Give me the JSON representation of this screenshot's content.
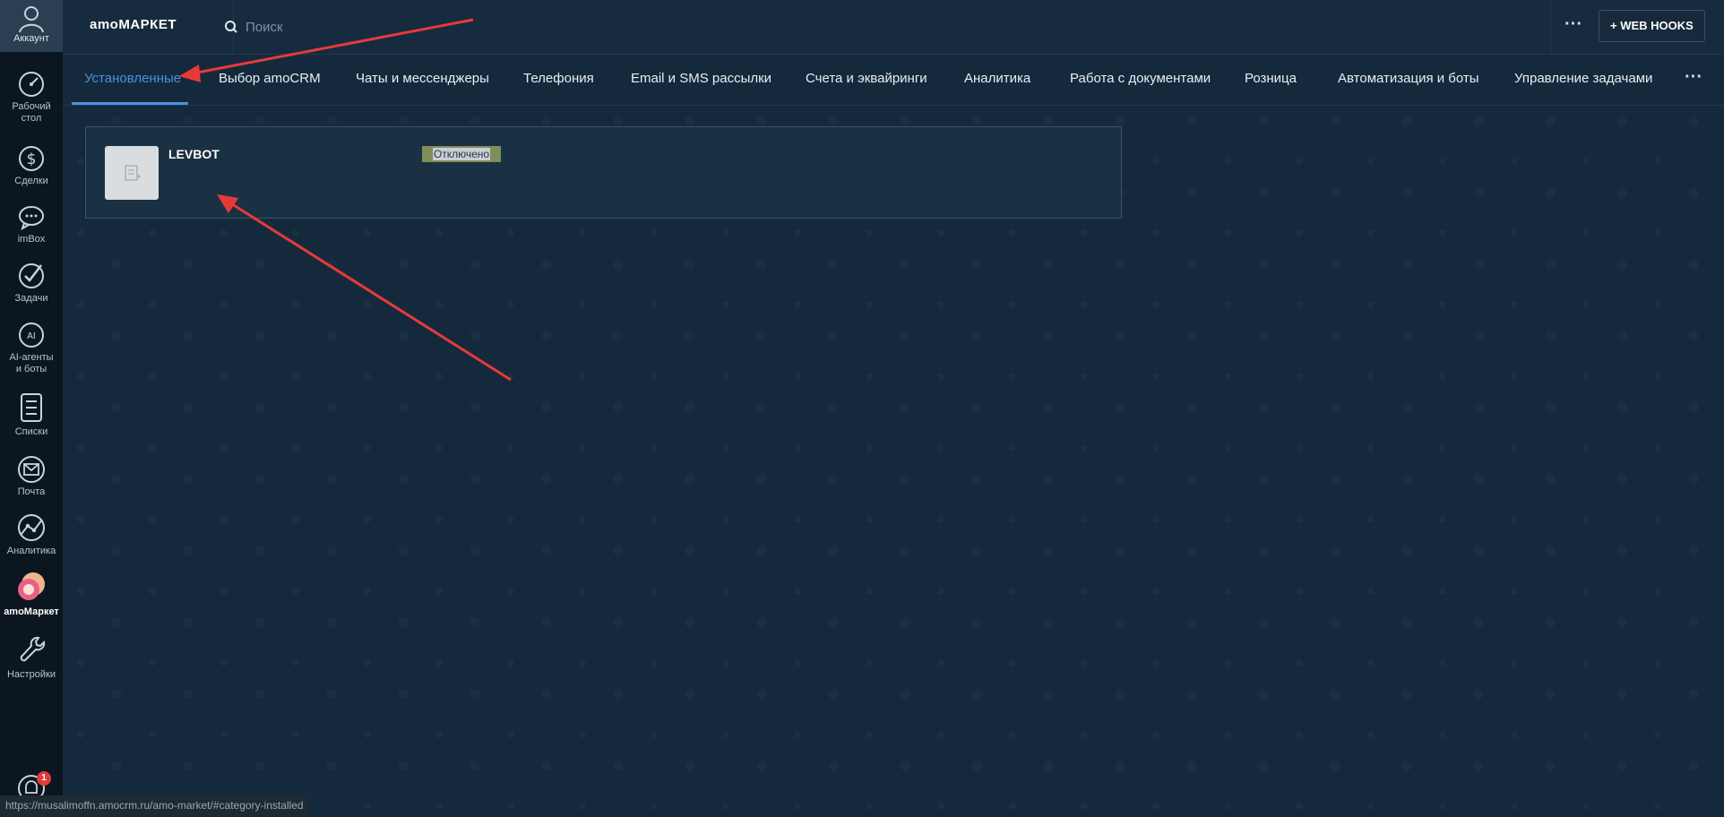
{
  "sidebar": {
    "account_label": "Аккаунт",
    "items": [
      {
        "label": "Рабочий стол",
        "line1": "Рабочий",
        "line2": "стол",
        "icon": "dashboard-icon"
      },
      {
        "label": "Сделки",
        "icon": "deals-icon"
      },
      {
        "label": "imBox",
        "icon": "chat-icon"
      },
      {
        "label": "Задачи",
        "icon": "tasks-icon"
      },
      {
        "label": "AI-агенты и боты",
        "line1": "AI-агенты",
        "line2": "и боты",
        "icon": "ai-icon"
      },
      {
        "label": "Списки",
        "icon": "lists-icon"
      },
      {
        "label": "Почта",
        "icon": "mail-icon"
      },
      {
        "label": "Аналитика",
        "icon": "analytics-icon"
      },
      {
        "label": "amoМаркет",
        "icon": "market-icon",
        "active": true
      },
      {
        "label": "Настройки",
        "icon": "wrench-icon"
      }
    ],
    "notifications_badge": "1"
  },
  "topbar": {
    "brand": "amoМАРКЕТ",
    "search_placeholder": "Поиск",
    "more_label": "···",
    "webhooks_label": "+ WEB HOOKS"
  },
  "tabs": [
    {
      "label": "Установленные",
      "active": true
    },
    {
      "label": "Выбор amoCRM"
    },
    {
      "label": "Чаты и мессенджеры"
    },
    {
      "label": "Телефония"
    },
    {
      "label": "Email и SMS рассылки"
    },
    {
      "label": "Счета и эквайринги"
    },
    {
      "label": "Аналитика"
    },
    {
      "label": "Работа с документами"
    },
    {
      "label": "Розница"
    },
    {
      "label": "Автоматизация и боты"
    },
    {
      "label": "Управление задачами"
    }
  ],
  "tabs_more_label": "···",
  "widgets": [
    {
      "name": "LEVBOT",
      "status": "Отключено"
    }
  ],
  "status_bar_url": "https://musalimoffn.amocrm.ru/amo-market/#category-installed",
  "colors": {
    "accent": "#4d8fe0",
    "annotation_arrow": "#e8393a",
    "status_badge": "#7f8e5a"
  }
}
